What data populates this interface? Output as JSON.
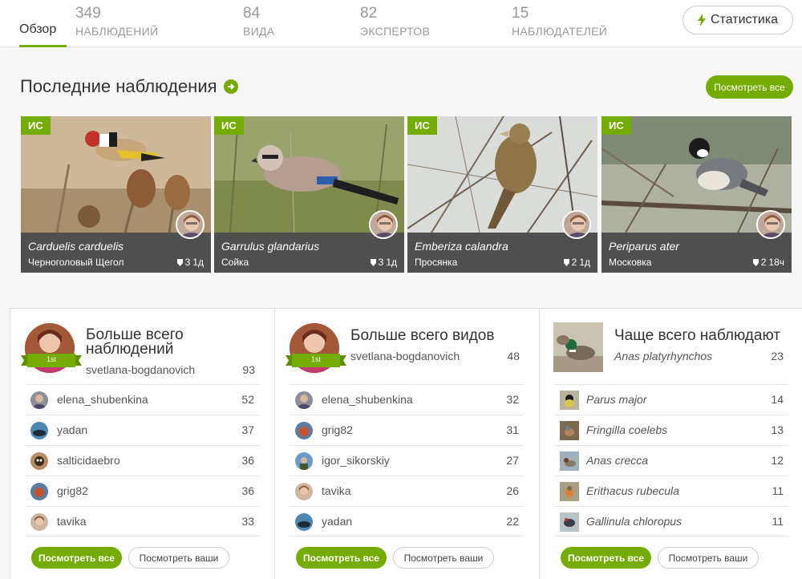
{
  "topbar": {
    "overview_label": "Обзор",
    "stats": [
      {
        "number": "349",
        "label": "НАБЛЮДЕНИЙ"
      },
      {
        "number": "84",
        "label": "ВИДА"
      },
      {
        "number": "82",
        "label": "ЭКСПЕРТОВ"
      },
      {
        "number": "15",
        "label": "НАБЛЮДАТЕЛЕЙ"
      }
    ],
    "statistics_button": "Статистика"
  },
  "recent": {
    "title": "Последние наблюдения",
    "view_all": "Посмотреть все",
    "cards": [
      {
        "badge": "ИС",
        "scientific": "Carduelis carduelis",
        "common": "Черноголовый Щегол",
        "ids": "3",
        "age": "1д"
      },
      {
        "badge": "ИС",
        "scientific": "Garrulus glandarius",
        "common": "Сойка",
        "ids": "3",
        "age": "1д"
      },
      {
        "badge": "ИС",
        "scientific": "Emberiza calandra",
        "common": "Просянка",
        "ids": "2",
        "age": "1д"
      },
      {
        "badge": "ИС",
        "scientific": "Periparus ater",
        "common": "Московка",
        "ids": "2",
        "age": "18ч"
      }
    ]
  },
  "panels": [
    {
      "title": "Больше всего наблюдений",
      "ribbon": "1st",
      "leader": {
        "name": "svetlana-bogdanovich",
        "count": "93"
      },
      "rows": [
        {
          "name": "elena_shubenkina",
          "count": "52"
        },
        {
          "name": "yadan",
          "count": "37"
        },
        {
          "name": "salticidaebro",
          "count": "36"
        },
        {
          "name": "grig82",
          "count": "36"
        },
        {
          "name": "tavika",
          "count": "33"
        }
      ],
      "view_all": "Посмотреть все",
      "view_yours": "Посмотреть ваши"
    },
    {
      "title": "Больше всего видов",
      "ribbon": "1st",
      "leader": {
        "name": "svetlana-bogdanovich",
        "count": "48"
      },
      "rows": [
        {
          "name": "elena_shubenkina",
          "count": "32"
        },
        {
          "name": "grig82",
          "count": "31"
        },
        {
          "name": "igor_sikorskiy",
          "count": "27"
        },
        {
          "name": "tavika",
          "count": "26"
        },
        {
          "name": "yadan",
          "count": "22"
        }
      ],
      "view_all": "Посмотреть все",
      "view_yours": "Посмотреть ваши"
    },
    {
      "title": "Чаще всего наблюдают",
      "leader": {
        "name": "Anas platyrhynchos",
        "count": "23"
      },
      "rows": [
        {
          "name": "Parus major",
          "count": "14"
        },
        {
          "name": "Fringilla coelebs",
          "count": "13"
        },
        {
          "name": "Anas crecca",
          "count": "12"
        },
        {
          "name": "Erithacus rubecula",
          "count": "11"
        },
        {
          "name": "Gallinula chloropus",
          "count": "11"
        }
      ],
      "view_all": "Посмотреть все",
      "view_yours": "Посмотреть ваши"
    }
  ],
  "colors": {
    "accent": "#74ac00",
    "caption_bg": "#4f4f4f",
    "muted_text": "#999999"
  }
}
